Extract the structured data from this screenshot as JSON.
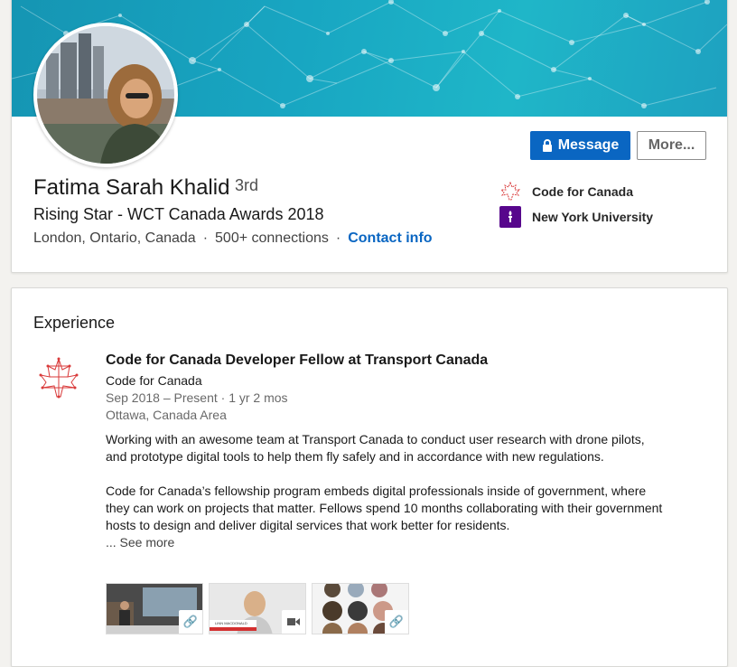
{
  "profile": {
    "name": "Fatima Sarah Khalid",
    "degree": "· 3rd",
    "headline": "Rising Star - WCT Canada Awards 2018",
    "location": "London, Ontario, Canada",
    "connections": "500+ connections",
    "contact_link": "Contact info",
    "separator": "·"
  },
  "actions": {
    "message_label": "Message",
    "more_label": "More..."
  },
  "organizations": [
    {
      "name": "Code for Canada",
      "icon": "maple-leaf-icon"
    },
    {
      "name": "New York University",
      "icon": "nyu-torch-icon"
    }
  ],
  "experience": {
    "section_title": "Experience",
    "job": {
      "title": "Code for Canada Developer Fellow at Transport Canada",
      "company": "Code for Canada",
      "dates": "Sep 2018 – Present · 1 yr 2 mos",
      "location": "Ottawa, Canada Area",
      "description_1": "Working with an awesome team at Transport Canada to conduct user research with drone pilots, and prototype digital tools to help them fly safely and in accordance with new regulations.",
      "description_2": "Code for Canada’s fellowship program embeds digital professionals inside of government, where they can work on projects that matter. Fellows spend 10 months collaborating with their government hosts to design and deliver digital services that work better for residents.",
      "see_more": "... See more"
    },
    "media": [
      {
        "type": "link",
        "icon": "link-icon"
      },
      {
        "type": "video",
        "icon": "video-icon",
        "caption": "LINN MACDONALD"
      },
      {
        "type": "link",
        "icon": "link-icon"
      }
    ]
  },
  "colors": {
    "accent": "#0a66c2",
    "banner": "#18a6c2",
    "nyu_purple": "#57068c",
    "maple_red": "#d93a3a"
  }
}
